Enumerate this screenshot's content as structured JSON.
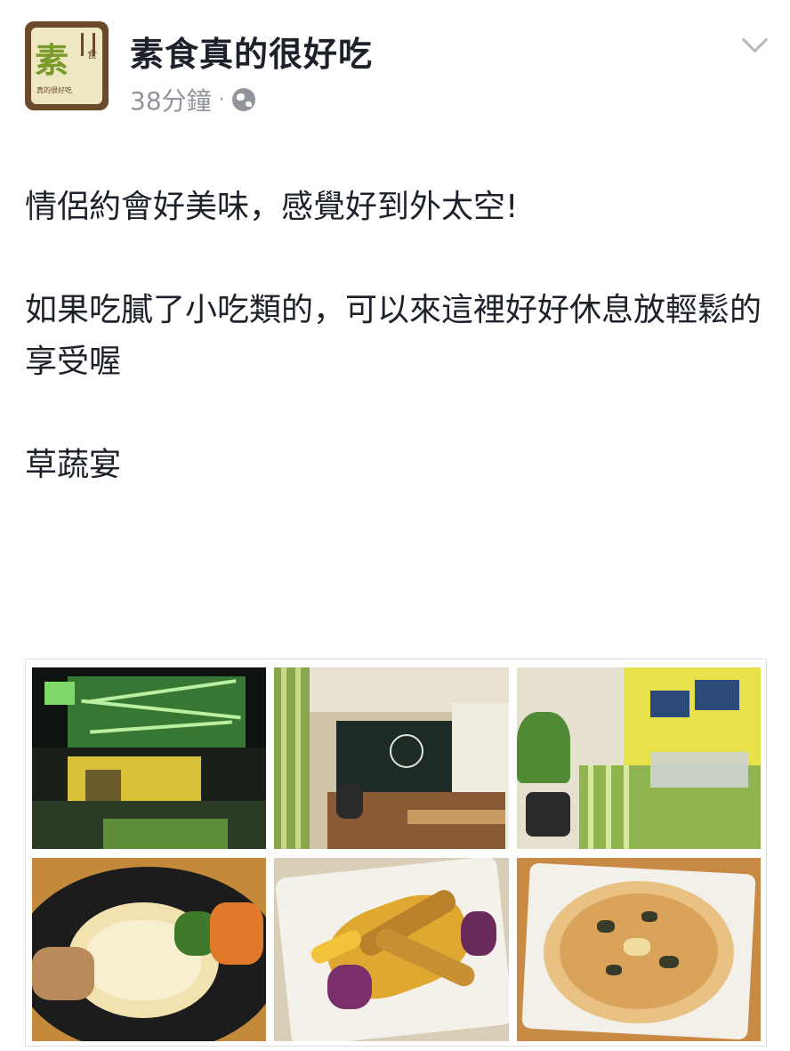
{
  "post": {
    "page_name": "素食真的很好吃",
    "timestamp": "38分鐘",
    "separator": "·",
    "privacy_icon": "globe-icon",
    "menu_icon": "chevron-down-icon",
    "avatar": {
      "big_char": "素",
      "small_char": "食",
      "subtitle": "真的很好吃"
    },
    "text": {
      "line1": "情侶約會好美味，感覺好到外太空!",
      "line2": "如果吃膩了小吃類的，可以來這裡好好休息放輕鬆的享受喔",
      "line3": "草蔬宴"
    }
  },
  "photos": [
    {
      "id": "storefront-night"
    },
    {
      "id": "dining-room"
    },
    {
      "id": "counter-area"
    },
    {
      "id": "pasta-dish"
    },
    {
      "id": "fried-vegetables"
    },
    {
      "id": "pizza"
    }
  ],
  "colors": {
    "text_primary": "#1d2129",
    "text_secondary": "#90949c",
    "border": "#dddfe2",
    "avatar_frame": "#6b4a2a",
    "avatar_accent": "#7a9a2a"
  }
}
